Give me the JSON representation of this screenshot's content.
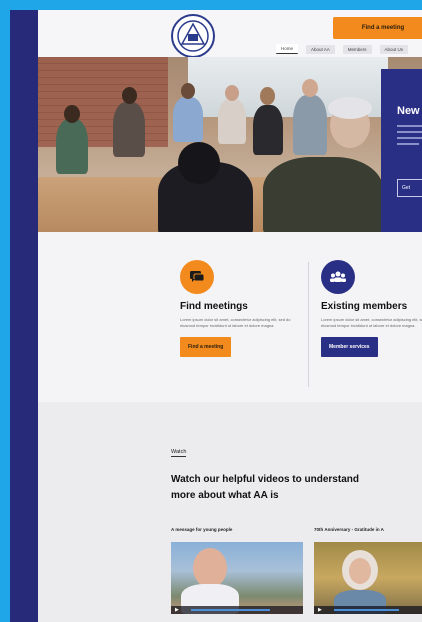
{
  "header": {
    "cta_label": "Find a meeting",
    "nav": [
      "Home",
      "About AA",
      "Members",
      "About Us"
    ]
  },
  "hero": {
    "panel_title": "New",
    "panel_button": "Get"
  },
  "services": [
    {
      "title": "Find meetings",
      "text": "Lorem ipsum dolor sit amet, consectetur adipiscing elit, sed do eiusmod tempor incididunt ut labore et dolore magna.",
      "button": "Find a meeting",
      "color": "#f28a1e"
    },
    {
      "title": "Existing members",
      "text": "Lorem ipsum dolor sit amet, consectetur adipiscing elit, sed do eiusmod tempor incididunt ut labore et dolore magna.",
      "button": "Member services",
      "color": "#2a2f86"
    }
  ],
  "watch": {
    "eyebrow": "Watch",
    "heading": "Watch our helpful videos to understand more about what AA is",
    "videos": [
      {
        "label": "A message for young people"
      },
      {
        "label": "70th Anniversary - Gratitude in A"
      }
    ]
  },
  "colors": {
    "accent_orange": "#f28a1e",
    "brand_navy": "#2a2f86",
    "frame_blue": "#1fa6e8"
  }
}
